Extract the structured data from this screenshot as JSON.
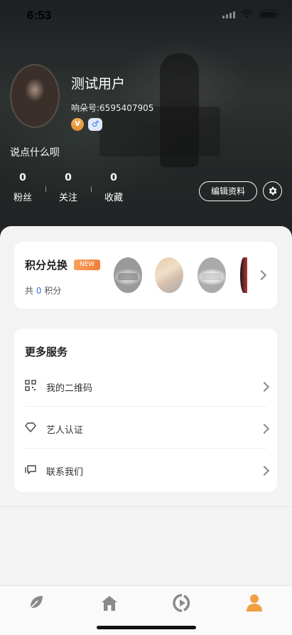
{
  "status_bar": {
    "time": "6:53"
  },
  "profile": {
    "username": "测试用户",
    "uid_text": "响朵号:6595407905",
    "badge_level": "V",
    "badge_gender": "♂",
    "bio": "说点什么呗",
    "stats": [
      {
        "value": "0",
        "label": "粉丝"
      },
      {
        "value": "0",
        "label": "关注"
      },
      {
        "value": "0",
        "label": "收藏"
      }
    ],
    "edit_button": "编辑资料"
  },
  "points": {
    "title": "积分兑换",
    "new_tag": "NEW",
    "total_prefix": "共",
    "total_value": "0",
    "total_suffix": "积分"
  },
  "services": {
    "title": "更多服务",
    "items": [
      {
        "label": "我的二维码",
        "icon": "qrcode-icon"
      },
      {
        "label": "艺人认证",
        "icon": "diamond-icon"
      },
      {
        "label": "联系我们",
        "icon": "chat-icon"
      }
    ]
  },
  "tabs": [
    {
      "name": "discover",
      "icon": "leaf-icon",
      "active": false
    },
    {
      "name": "home",
      "icon": "home-icon",
      "active": false
    },
    {
      "name": "play",
      "icon": "play-icon",
      "active": false
    },
    {
      "name": "mine",
      "icon": "user-icon",
      "active": true
    }
  ],
  "colors": {
    "accent": "#3a78e0",
    "tab_active": "#f0a040",
    "tag": "#f07c3a"
  }
}
